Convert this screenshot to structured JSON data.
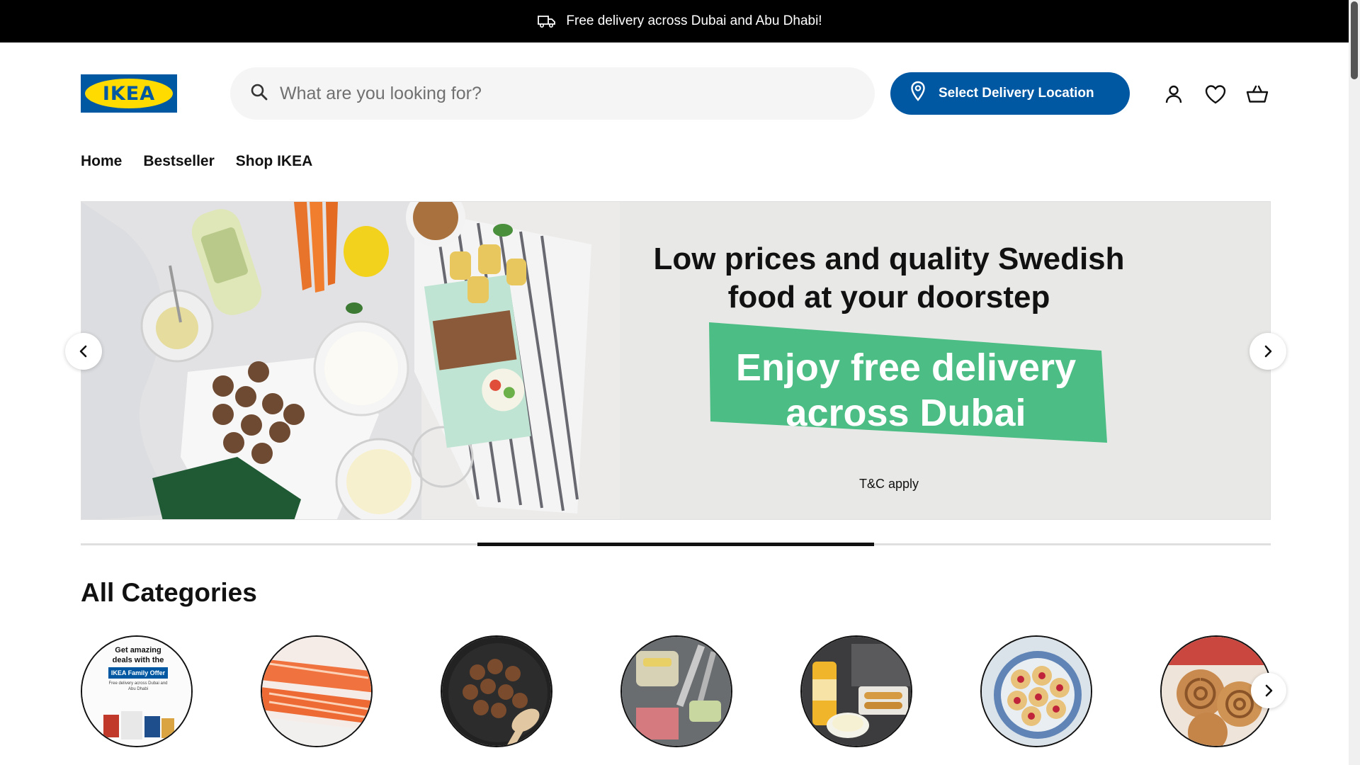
{
  "announcement": {
    "text": "Free delivery across Dubai and Abu Dhabi!",
    "icon": "truck-icon"
  },
  "brand": {
    "name": "IKEA",
    "blue": "#0058a3",
    "yellow": "#ffdb00"
  },
  "search": {
    "placeholder": "What are you looking for?",
    "value": ""
  },
  "delivery_button": {
    "label": "Select Delivery Location",
    "icon": "location-pin-icon"
  },
  "header_icons": [
    "account-icon",
    "wishlist-icon",
    "cart-icon"
  ],
  "nav": {
    "items": [
      "Home",
      "Bestseller",
      "Shop IKEA"
    ]
  },
  "hero": {
    "title_line1": "Low prices and quality Swedish",
    "title_line2": "food at your doorstep",
    "promo_line1": "Enjoy free delivery",
    "promo_line2": "across Dubai",
    "promo_color": "#4cbd84",
    "terms": "T&C apply",
    "slide_progress": {
      "active_index": 1,
      "total": 3
    }
  },
  "categories": {
    "title": "All Categories",
    "items": [
      {
        "caption_line1": "Get amazing",
        "caption_line2": "deals with the",
        "badge": "IKEA Family Offer",
        "fine_print": "Free delivery across Dubai and Abu Dhabi"
      },
      {
        "image": "salmon"
      },
      {
        "image": "meatballs"
      },
      {
        "image": "kitchen-utensils"
      },
      {
        "image": "sauce-and-snacks"
      },
      {
        "image": "heart-biscuits"
      },
      {
        "image": "cinnamon-buns"
      }
    ]
  }
}
